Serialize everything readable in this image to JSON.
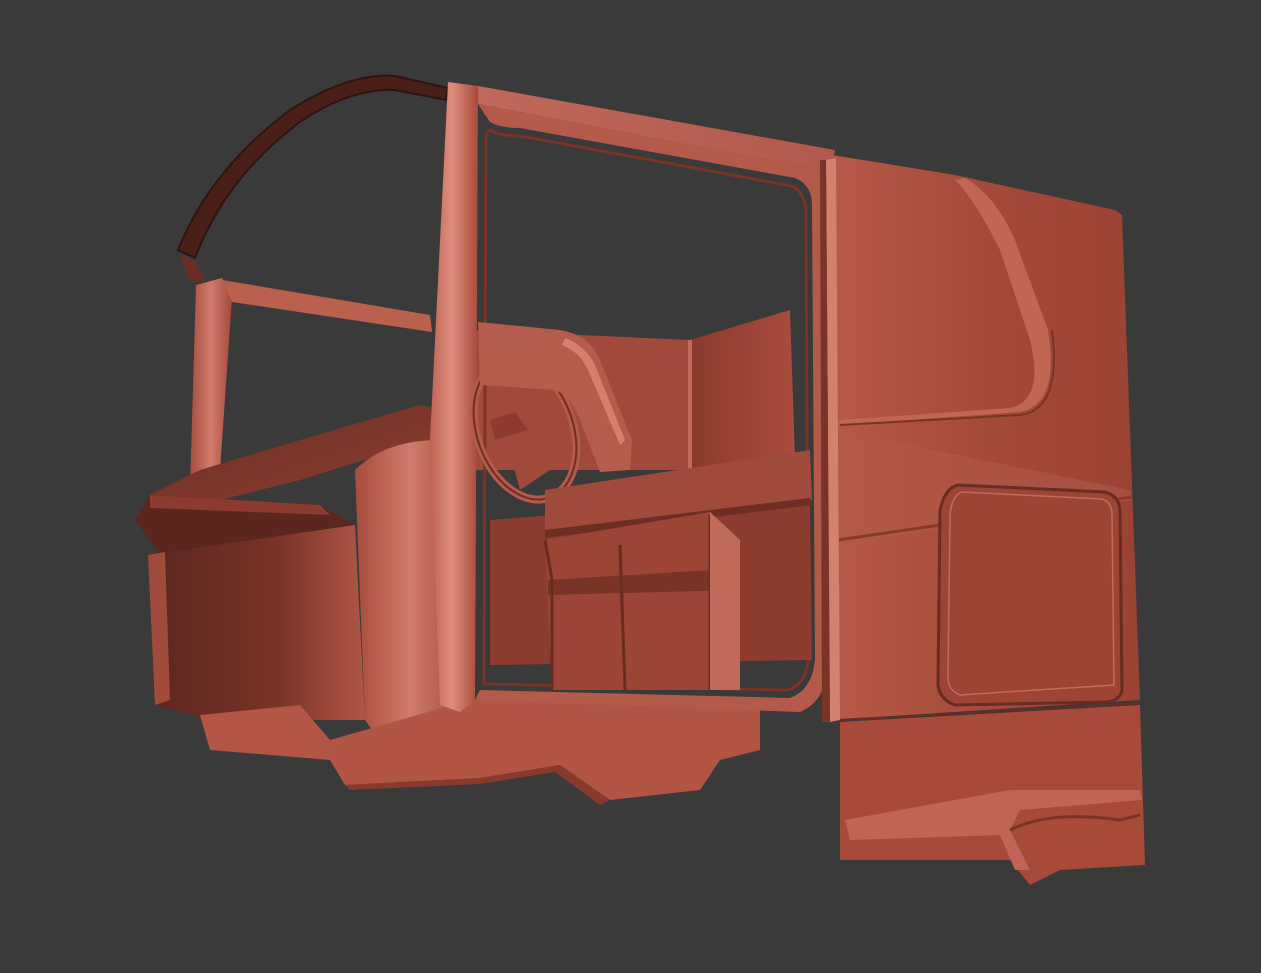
{
  "scene": {
    "background_color": "#3a3a3a",
    "subject": "truck-cab-clay-model",
    "colors": {
      "clay_base": "#a8493a",
      "clay_light": "#c6685a",
      "clay_highlight": "#d98676",
      "clay_mid": "#9a4233",
      "clay_dark": "#6e2e24",
      "clay_shadow": "#4e211b",
      "edge_dark": "#3b1813"
    }
  }
}
